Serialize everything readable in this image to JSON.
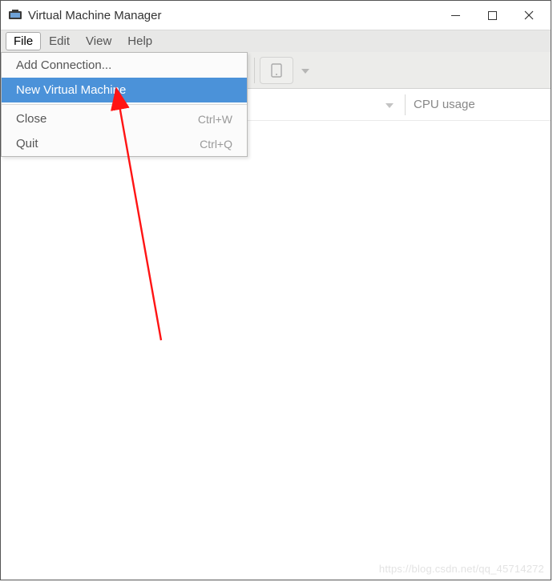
{
  "titlebar": {
    "title": "Virtual Machine Manager"
  },
  "menubar": {
    "file": "File",
    "edit": "Edit",
    "view": "View",
    "help": "Help"
  },
  "columns": {
    "cpu": "CPU usage"
  },
  "file_menu": {
    "add_connection": "Add Connection...",
    "new_vm": "New Virtual Machine",
    "close": "Close",
    "close_shortcut": "Ctrl+W",
    "quit": "Quit",
    "quit_shortcut": "Ctrl+Q"
  },
  "watermark": "https://blog.csdn.net/qq_45714272"
}
